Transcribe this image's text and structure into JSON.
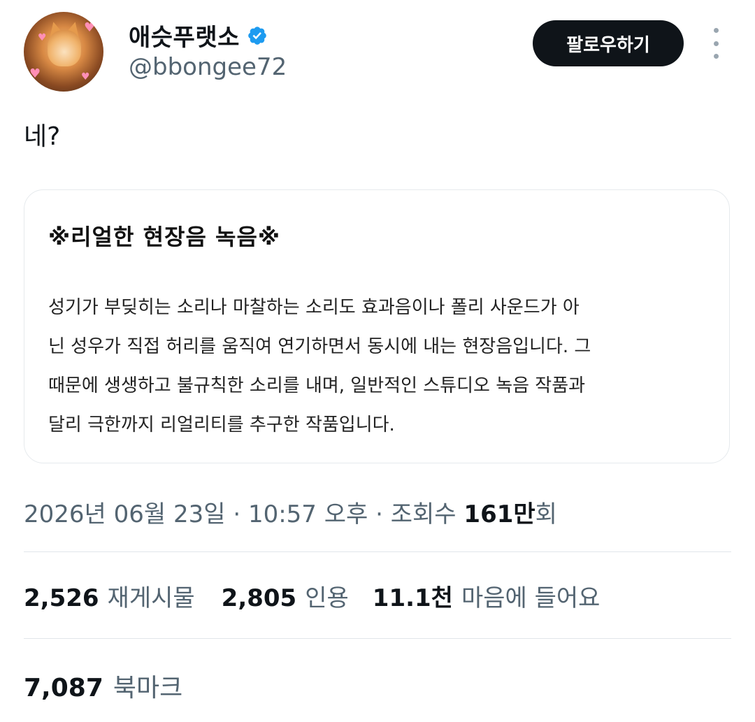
{
  "profile": {
    "display_name": "애슷푸랫소",
    "handle": "@bbongee72",
    "verified_icon": "verified-badge-icon",
    "avatar_icon": "cat-avatar"
  },
  "actions": {
    "follow_label": "팔로우하기",
    "more_icon": "more-vertical-icon"
  },
  "tweet": {
    "text": "네?"
  },
  "card": {
    "title": "※리얼한 현장음 녹음※",
    "body_lines": [
      "성기가 부딪히는 소리나 마찰하는 소리도 효과음이나 폴리 사운드가 아",
      "닌 성우가 직접 허리를 움직여 연기하면서 동시에 내는 현장음입니다. 그",
      "때문에 생생하고 불규칙한 소리를 내며, 일반적인 스튜디오 녹음 작품과",
      "달리 극한까지 리얼리티를 추구한 작품입니다."
    ]
  },
  "meta": {
    "date": "2026년 06월 23일",
    "sep": " · ",
    "time": "10:57 오후",
    "views_prefix": "조회수 ",
    "views_count": "161만",
    "views_suffix": "회"
  },
  "stats": {
    "reposts_count": "2,526",
    "reposts_label": "재게시물",
    "quotes_count": "2,805",
    "quotes_label": "인용",
    "likes_count": "11.1천",
    "likes_label": "마음에 들어요",
    "bookmarks_count": "7,087",
    "bookmarks_label": "북마크"
  },
  "colors": {
    "text_primary": "#0f1419",
    "text_secondary": "#536471",
    "verified_blue": "#1d9bf0",
    "button_bg": "#0f1419"
  }
}
